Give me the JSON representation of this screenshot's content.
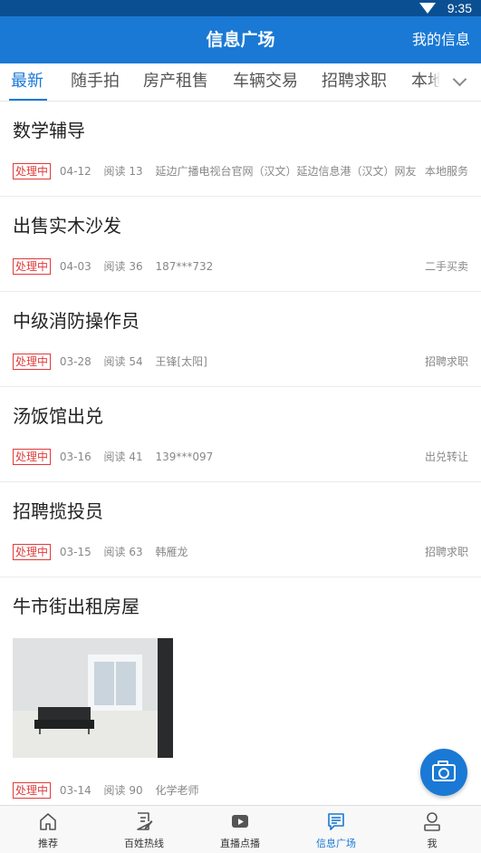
{
  "status_bar": {
    "time": "9:35"
  },
  "app_bar": {
    "title": "信息广场",
    "right_link": "我的信息"
  },
  "tabs": [
    "最新",
    "随手拍",
    "房产租售",
    "车辆交易",
    "招聘求职",
    "本地"
  ],
  "active_tab": 0,
  "posts": [
    {
      "title": "数学辅导",
      "status": "处理中",
      "date": "04-12",
      "reads": "阅读 13",
      "author": "延边广播电视台官网（汉文）延边信息港（汉文）网友",
      "category": "本地服务"
    },
    {
      "title": "出售实木沙发",
      "status": "处理中",
      "date": "04-03",
      "reads": "阅读 36",
      "author": "187***732",
      "category": "二手买卖"
    },
    {
      "title": "中级消防操作员",
      "status": "处理中",
      "date": "03-28",
      "reads": "阅读 54",
      "author": "王锋[太阳]",
      "category": "招聘求职"
    },
    {
      "title": "汤饭馆出兑",
      "status": "处理中",
      "date": "03-16",
      "reads": "阅读 41",
      "author": "139***097",
      "category": "出兑转让"
    },
    {
      "title": "招聘揽投员",
      "status": "处理中",
      "date": "03-15",
      "reads": "阅读 63",
      "author": "韩雁龙",
      "category": "招聘求职"
    },
    {
      "title": "牛市街出租房屋",
      "status": "处理中",
      "date": "03-14",
      "reads": "阅读 90",
      "author": "化学老师",
      "category": ""
    }
  ],
  "bottom_nav": [
    {
      "label": "推荐",
      "icon": "home-icon"
    },
    {
      "label": "百姓热线",
      "icon": "document-edit-icon"
    },
    {
      "label": "直播点播",
      "icon": "play-video-icon"
    },
    {
      "label": "信息广场",
      "icon": "message-list-icon"
    },
    {
      "label": "我",
      "icon": "user-icon"
    }
  ],
  "active_nav": 3,
  "colors": {
    "primary": "#1a79d4",
    "status_bar": "#0b4f93",
    "badge": "#e03a3a"
  }
}
